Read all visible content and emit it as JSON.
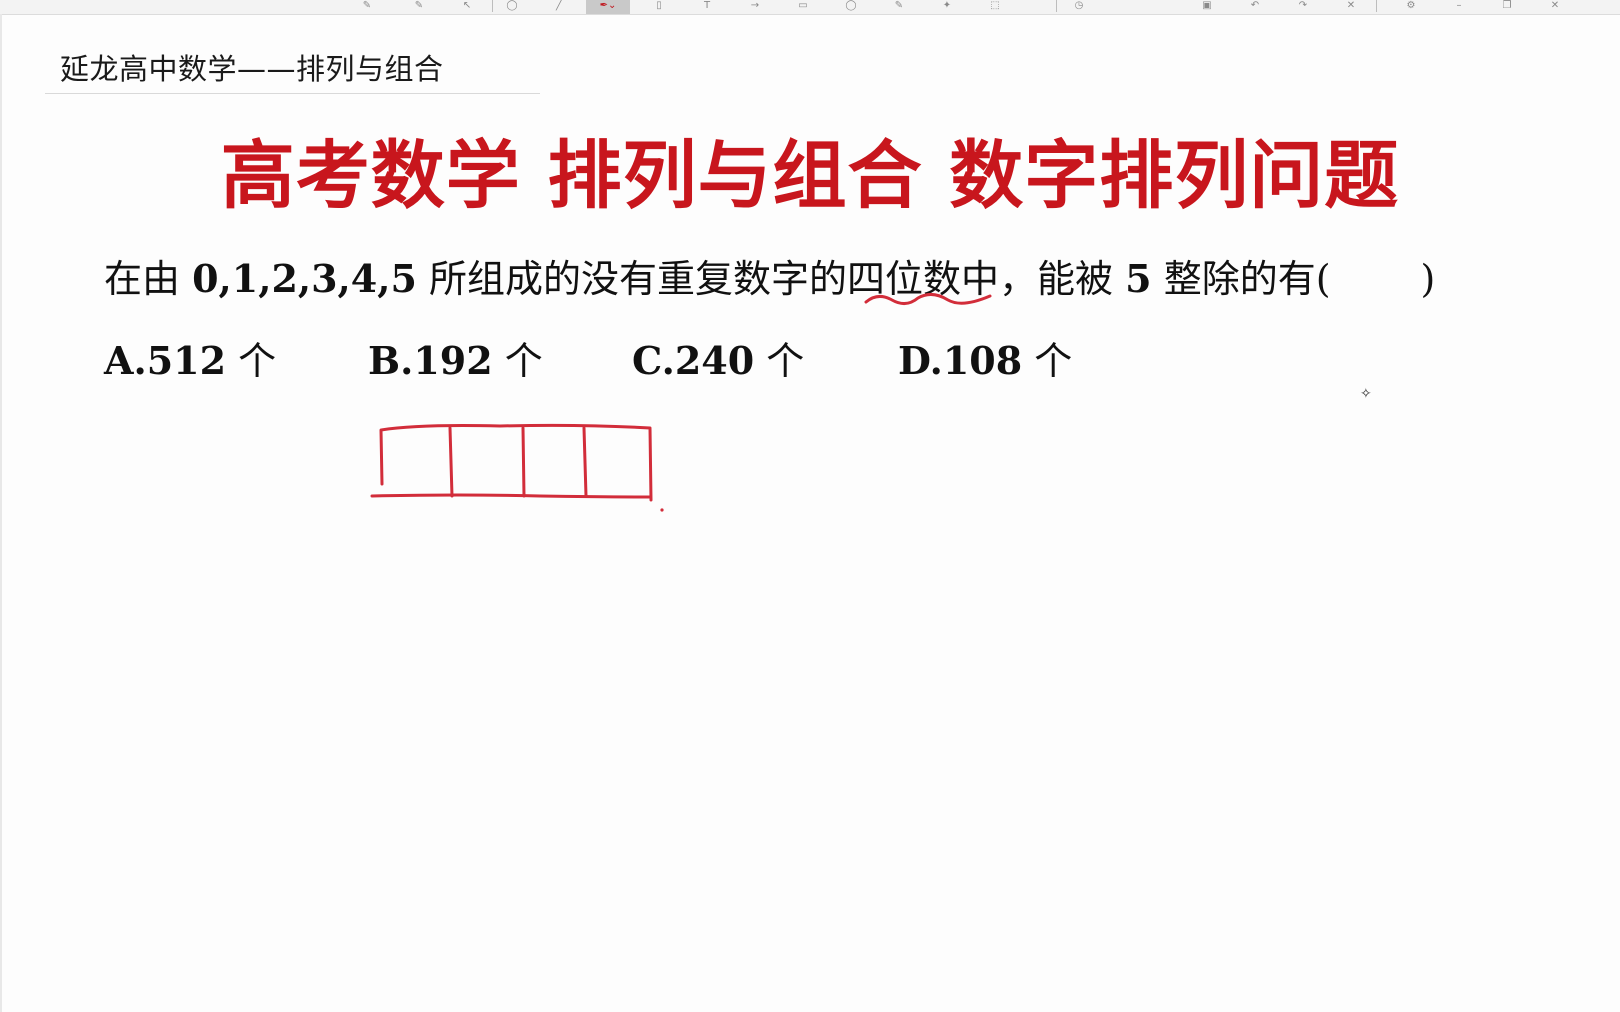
{
  "header": {
    "text": "延龙高中数学——排列与组合"
  },
  "title": "高考数学 排列与组合 数字排列问题",
  "question": {
    "prefix": "在由",
    "digits": "0,1,2,3,4,5",
    "mid1": "所组成的没有重复数字的",
    "emphasis": "四位数",
    "mid2": "中，能被",
    "number": "5",
    "suffix": "整除的有(",
    "close": ")"
  },
  "options": [
    {
      "letter": "A.",
      "value": "512",
      "unit": "个"
    },
    {
      "letter": "B.",
      "value": "192",
      "unit": "个"
    },
    {
      "letter": "C.",
      "value": "240",
      "unit": "个"
    },
    {
      "letter": "D.",
      "value": "108",
      "unit": "个"
    }
  ],
  "colors": {
    "title": "#c8161d",
    "ink": "#d22d3a",
    "text": "#111111"
  }
}
